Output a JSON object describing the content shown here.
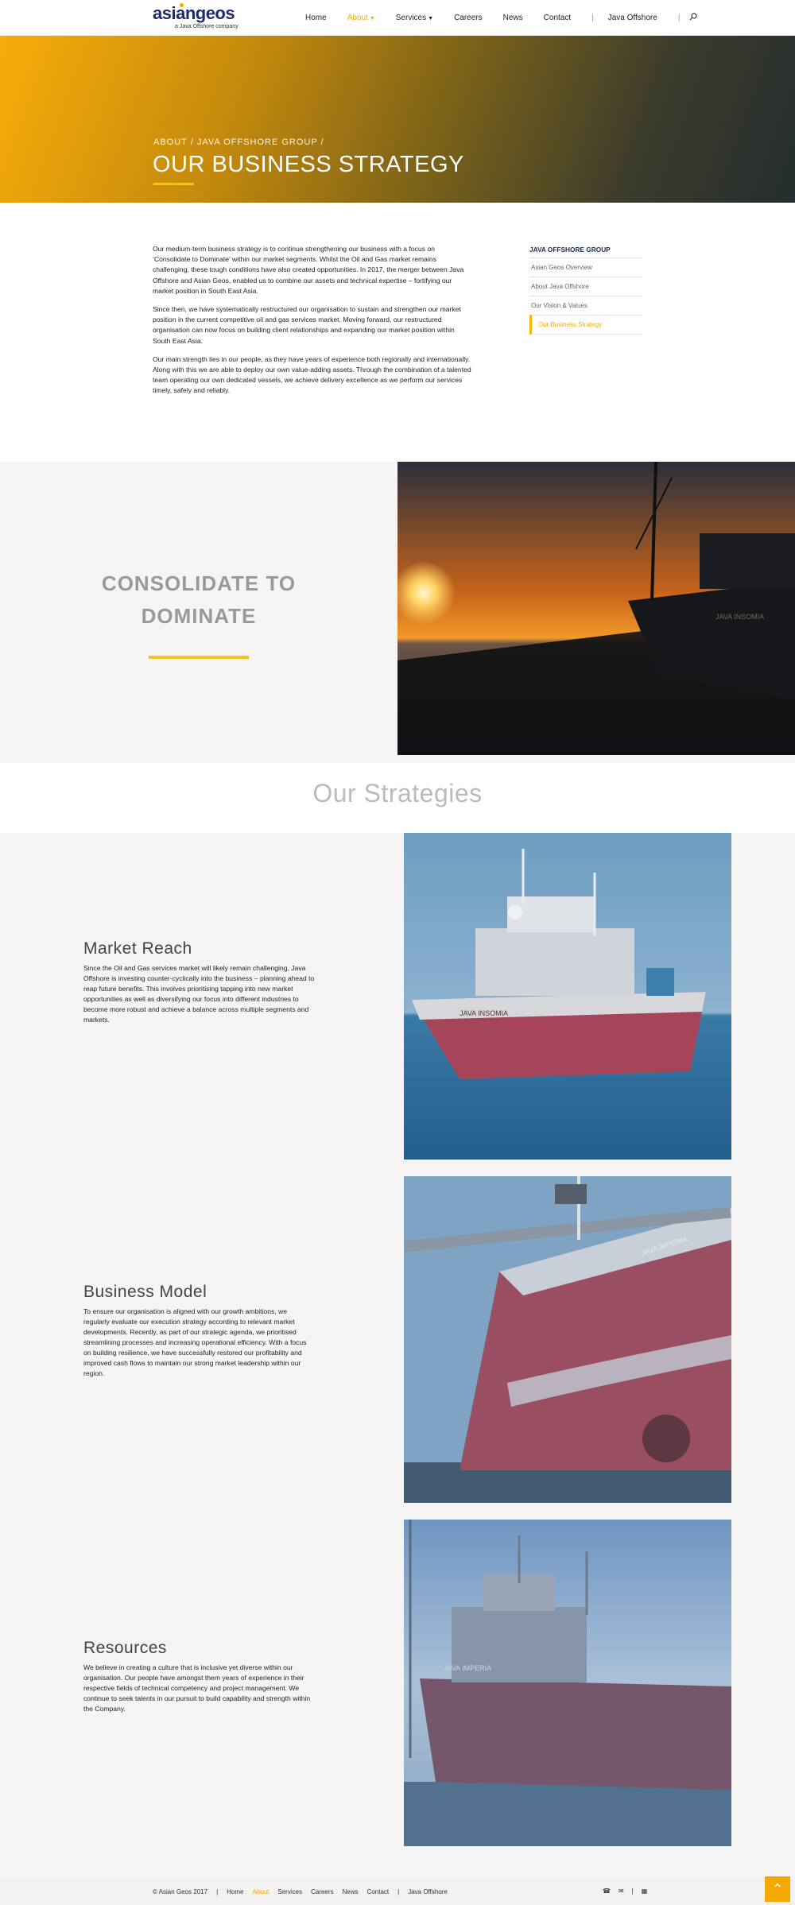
{
  "header": {
    "logo_text": "asiangeos",
    "logo_sub": "a Java Offshore company",
    "nav": [
      {
        "label": "Home"
      },
      {
        "label": "About"
      },
      {
        "label": "Services"
      },
      {
        "label": "Careers"
      },
      {
        "label": "News"
      },
      {
        "label": "Contact"
      },
      {
        "label": "Java Offshore"
      }
    ]
  },
  "hero": {
    "breadcrumb": "ABOUT / JAVA OFFSHORE GROUP /",
    "title": "OUR BUSINESS STRATEGY"
  },
  "intro": {
    "paragraphs": [
      "Our medium-term business strategy is to continue strengthening our business with a focus on ‘Consolidate to Dominate’ within our market segments. Whilst the Oil and Gas market remains challenging, these tough conditions have also created opportunities. In 2017, the merger between Java Offshore and Asian Geos, enabled us to combine our assets and technical expertise – fortifying our market position in South East Asia.",
      "Since then, we have systematically restructured our organisation to sustain and strengthen our market position in the current competitive oil and gas services market. Moving forward, our restructured organisation can now focus on building client relationships and expanding our market position within South East Asia.",
      "Our main strength lies in our people, as they have years of experience both regionally and internationally. Along with this we are able to deploy our own value-adding assets. Through the combination of a talented team operating our own dedicated vessels, we achieve delivery excellence as we perform our services timely, safely and reliably."
    ]
  },
  "sidebar": {
    "title": "JAVA OFFSHORE GROUP",
    "items": [
      {
        "label": "Asian Geos Overview"
      },
      {
        "label": "About Java Offshore"
      },
      {
        "label": "Our Vision & Values"
      },
      {
        "label": "Our Business Strategy"
      }
    ]
  },
  "band": {
    "line1": "CONSOLIDATE TO",
    "line2": "DOMINATE"
  },
  "strategies": {
    "heading": "Our Strategies",
    "items": [
      {
        "title": "Market Reach",
        "body": "Since the Oil and Gas services market will likely remain challenging, Java Offshore is investing counter-cyclically into the business – planning ahead to reap future benefits. This involves prioritising tapping into new market opportunities as well as diversifying our focus into different industries to become more robust and achieve a balance across multiple segments and markets.",
        "ship_label": "JAVA INSOMIA"
      },
      {
        "title": "Business Model",
        "body": "To ensure our organisation is aligned with our growth ambitions, we regularly evaluate our execution strategy according to relevant market developments. Recently, as part of our strategic agenda, we prioritised streamlining processes and increasing operational efficiency. With a focus on building resilience, we have successfully restored our profitability and improved cash flows to maintain our strong market leadership within our region.",
        "ship_label": "JAVA IMPERIA"
      },
      {
        "title": "Resources",
        "body": "We believe in creating a culture that is inclusive yet diverse within our organisation. Our people have amongst them years of experience in their respective fields of technical competency and project management. We continue to seek talents in our pursuit to build capability and strength within the Company.",
        "ship_label": "JAVA IMPERIA"
      }
    ]
  },
  "sunset_ship_label": "JAVA INSOMIA",
  "footer": {
    "copyright": "© Asian Geos 2017",
    "links": [
      {
        "label": "Home"
      },
      {
        "label": "About"
      },
      {
        "label": "Services"
      },
      {
        "label": "Careers"
      },
      {
        "label": "News"
      },
      {
        "label": "Contact"
      },
      {
        "label": "Java Offshore"
      }
    ]
  },
  "colors": {
    "accent": "#f5a800",
    "brand": "#1c2a6e"
  }
}
